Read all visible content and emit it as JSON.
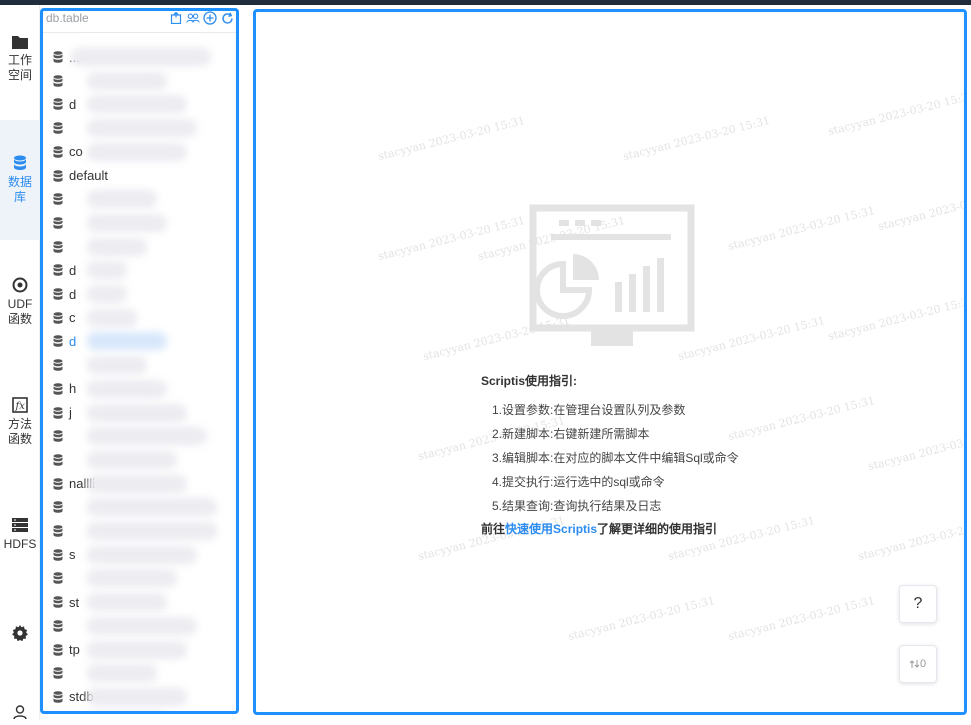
{
  "nav": {
    "items": [
      {
        "label": "工作空间",
        "icon": "folder-icon"
      },
      {
        "label": "数据库",
        "icon": "database-icon"
      },
      {
        "label": "UDF函数",
        "icon": "udf-icon"
      },
      {
        "label": "方法函数",
        "icon": "function-icon"
      },
      {
        "label": "HDFS",
        "icon": "hdfs-icon"
      }
    ],
    "settings_icon": "gear-icon",
    "user_icon": "user-icon"
  },
  "tree": {
    "title": "db.table",
    "tools": [
      "export-icon",
      "refresh-group-icon",
      "add-icon",
      "refresh-icon"
    ],
    "items": [
      "",
      "",
      "",
      "",
      "",
      "default",
      "",
      "",
      "",
      "",
      "",
      "",
      "",
      "",
      "",
      "",
      "",
      "",
      "",
      "",
      "",
      "",
      "",
      "",
      "",
      "",
      "",
      "",
      ""
    ],
    "partial": {
      "0": "...",
      "2": "d",
      "4": "co",
      "9": "d",
      "10": "d",
      "11": "c",
      "12": "d",
      "14": "h",
      "15": "j",
      "18": "nallli",
      "21": "s",
      "23": "st",
      "25": "tp",
      "27": "stdb"
    },
    "selected_index": 12
  },
  "main": {
    "watermark": "stacyyan 2023-03-20 15:31",
    "guide": {
      "title": "Scriptis使用指引:",
      "steps": [
        "1.设置参数:在管理台设置队列及参数",
        "2.新建脚本:右键新建所需脚本",
        "3.编辑脚本:在对应的脚本文件中编辑Sql或命令",
        "4.提交执行:运行选中的sql或命令",
        "5.结果查询:查询执行结果及日志"
      ],
      "foot_prefix": "前往",
      "foot_link": "快速使用Scriptis",
      "foot_suffix": "了解更详细的使用指引"
    },
    "help_label": "?",
    "counter_label": "0"
  },
  "colors": {
    "accent": "#2d8cf0",
    "border": "#1e90ff"
  }
}
